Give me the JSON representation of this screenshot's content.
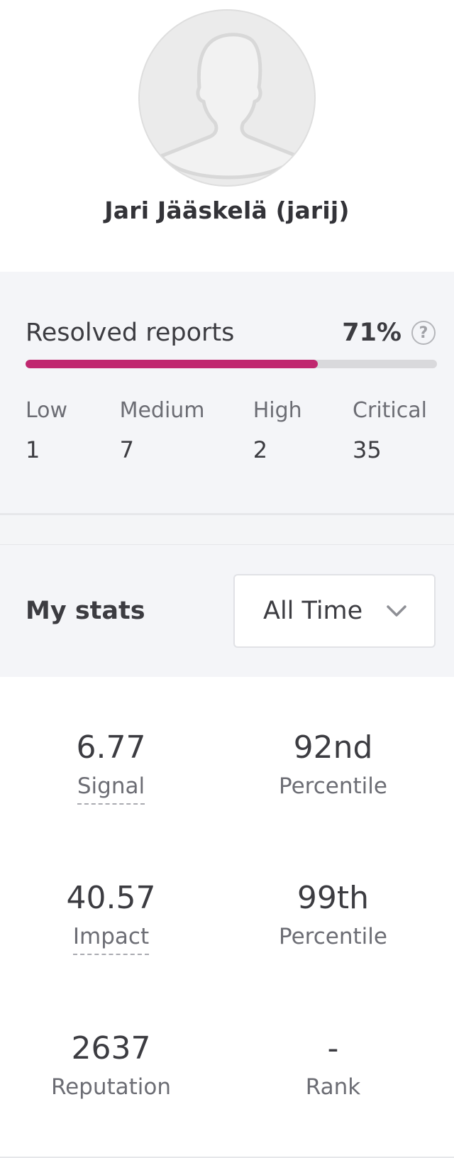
{
  "profile": {
    "name": "Jari Jääskelä (jarij)",
    "avatar_icon": "default-user-silhouette-icon"
  },
  "resolved_reports": {
    "label": "Resolved reports",
    "percent_text": "71%",
    "percent_value": 0.71,
    "help_icon": "question-circle-icon",
    "help_glyph": "?",
    "accent_color": "#c0276f",
    "severities": [
      {
        "label": "Low",
        "value": "1"
      },
      {
        "label": "Medium",
        "value": "7"
      },
      {
        "label": "High",
        "value": "2"
      },
      {
        "label": "Critical",
        "value": "35"
      }
    ]
  },
  "my_stats": {
    "title": "My stats",
    "period_select": {
      "value": "All Time",
      "icon": "chevron-down-icon"
    },
    "stats": [
      {
        "value": "6.77",
        "label": "Signal"
      },
      {
        "value": "92nd",
        "label": "Percentile"
      },
      {
        "value": "40.57",
        "label": "Impact"
      },
      {
        "value": "99th",
        "label": "Percentile"
      },
      {
        "value": "2637",
        "label": "Reputation"
      },
      {
        "value": "-",
        "label": "Rank"
      }
    ]
  }
}
